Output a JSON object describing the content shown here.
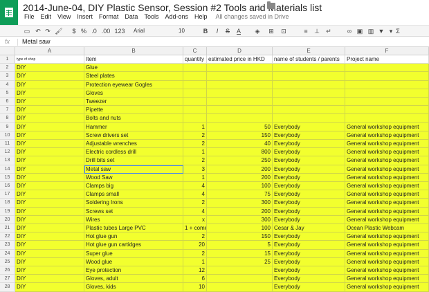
{
  "document": {
    "title": "2014-June-04, DIY Plastic Sensor, Session #2 Tools and Materials list",
    "save_status": "All changes saved in Drive"
  },
  "menu": [
    "File",
    "Edit",
    "View",
    "Insert",
    "Format",
    "Data",
    "Tools",
    "Add-ons",
    "Help"
  ],
  "toolbar": {
    "currency": "$",
    "percent": "%",
    "decimal_less": ".0",
    "decimal_more": ".00",
    "more_formats": "123",
    "font": "Arial",
    "font_size": "10",
    "bold": "B",
    "italic": "I",
    "strike": "S",
    "text_color": "A",
    "sigma": "Σ"
  },
  "formula_bar": {
    "fx": "fx",
    "value": "Metal saw"
  },
  "columns": [
    "A",
    "B",
    "C",
    "D",
    "E",
    "F"
  ],
  "header_row": {
    "row": "1",
    "a": "type of shop",
    "b": "Item",
    "c": "quantity",
    "d": "estimated price in HKD",
    "e": "name of students / parents",
    "f": "Project name"
  },
  "rows": [
    {
      "n": "2",
      "a": "DIY",
      "b": "Glue",
      "c": "",
      "d": "",
      "e": "",
      "f": ""
    },
    {
      "n": "3",
      "a": "DIY",
      "b": "Steel plates",
      "c": "",
      "d": "",
      "e": "",
      "f": ""
    },
    {
      "n": "4",
      "a": "DIY",
      "b": "Protection eyewear Gogles",
      "c": "",
      "d": "",
      "e": "",
      "f": ""
    },
    {
      "n": "5",
      "a": "DIY",
      "b": "Gloves",
      "c": "",
      "d": "",
      "e": "",
      "f": ""
    },
    {
      "n": "6",
      "a": "DIY",
      "b": "Tweezer",
      "c": "",
      "d": "",
      "e": "",
      "f": ""
    },
    {
      "n": "7",
      "a": "DIY",
      "b": "Pipette",
      "c": "",
      "d": "",
      "e": "",
      "f": ""
    },
    {
      "n": "8",
      "a": "DIY",
      "b": "Bolts and nuts",
      "c": "",
      "d": "",
      "e": "",
      "f": ""
    },
    {
      "n": "9",
      "a": "DIY",
      "b": "Hammer",
      "c": "1",
      "d": "50",
      "e": "Everybody",
      "f": "General workshop equipment"
    },
    {
      "n": "10",
      "a": "DIY",
      "b": "Screw drivers set",
      "c": "2",
      "d": "150",
      "e": "Everybody",
      "f": "General workshop equipment"
    },
    {
      "n": "11",
      "a": "DIY",
      "b": "Adjustable wrenches",
      "c": "2",
      "d": "40",
      "e": "Everybody",
      "f": "General workshop equipment"
    },
    {
      "n": "12",
      "a": "DIY",
      "b": "Electric cordless drill",
      "c": "1",
      "d": "800",
      "e": "Everybody",
      "f": "General workshop equipment"
    },
    {
      "n": "13",
      "a": "DIY",
      "b": "Drill bits set",
      "c": "2",
      "d": "250",
      "e": "Everybody",
      "f": "General workshop equipment"
    },
    {
      "n": "14",
      "a": "DIY",
      "b": "Metal saw",
      "c": "3",
      "d": "200",
      "e": "Everybody",
      "f": "General workshop equipment"
    },
    {
      "n": "15",
      "a": "DIY",
      "b": "Wood Saw",
      "c": "1",
      "d": "200",
      "e": "Everybody",
      "f": "General workshop equipment"
    },
    {
      "n": "16",
      "a": "DIY",
      "b": "Clamps big",
      "c": "4",
      "d": "100",
      "e": "Everybody",
      "f": "General workshop equipment"
    },
    {
      "n": "17",
      "a": "DIY",
      "b": "Clamps small",
      "c": "4",
      "d": "75",
      "e": "Everybody",
      "f": "General workshop equipment"
    },
    {
      "n": "18",
      "a": "DIY",
      "b": "Soldering Irons",
      "c": "2",
      "d": "300",
      "e": "Everybody",
      "f": "General workshop equipment"
    },
    {
      "n": "19",
      "a": "DIY",
      "b": "Screws set",
      "c": "4",
      "d": "200",
      "e": "Everybody",
      "f": "General workshop equipment"
    },
    {
      "n": "20",
      "a": "DIY",
      "b": "Wires",
      "c": "x",
      "d": "300",
      "e": "Everybody",
      "f": "General workshop equipment"
    },
    {
      "n": "21",
      "a": "DIY",
      "b": "Plastic tubes Large PVC",
      "c": "1 + come",
      "d": "100",
      "e": "Cesar & Jay",
      "f": "Ocean Plastic Webcam"
    },
    {
      "n": "22",
      "a": "DIY",
      "b": "Hot glue gun",
      "c": "2",
      "d": "150",
      "e": "Everybody",
      "f": "General workshop equipment"
    },
    {
      "n": "23",
      "a": "DIY",
      "b": "Hot glue gun cartidges",
      "c": "20",
      "d": "5",
      "e": "Everybody",
      "f": "General workshop equipment"
    },
    {
      "n": "24",
      "a": "DIY",
      "b": "Super glue",
      "c": "2",
      "d": "15",
      "e": "Everybody",
      "f": "General workshop equipment"
    },
    {
      "n": "25",
      "a": "DIY",
      "b": "Wood glue",
      "c": "1",
      "d": "25",
      "e": "Everybody",
      "f": "General workshop equipment"
    },
    {
      "n": "26",
      "a": "DIY",
      "b": "Eye protection",
      "c": "12",
      "d": "",
      "e": "Everybody",
      "f": "General workshop equipment"
    },
    {
      "n": "27",
      "a": "DIY",
      "b": "Gloves, adult",
      "c": "6",
      "d": "",
      "e": "Everybody",
      "f": "General workshop equipment"
    },
    {
      "n": "28",
      "a": "DIY",
      "b": "Gloves, kids",
      "c": "10",
      "d": "",
      "e": "Everybody",
      "f": "General workshop equipment"
    }
  ],
  "colors": {
    "highlight": "#f2ff2e",
    "logo": "#0f9d58",
    "selection": "#4285f4"
  },
  "selected_cell": "B14"
}
